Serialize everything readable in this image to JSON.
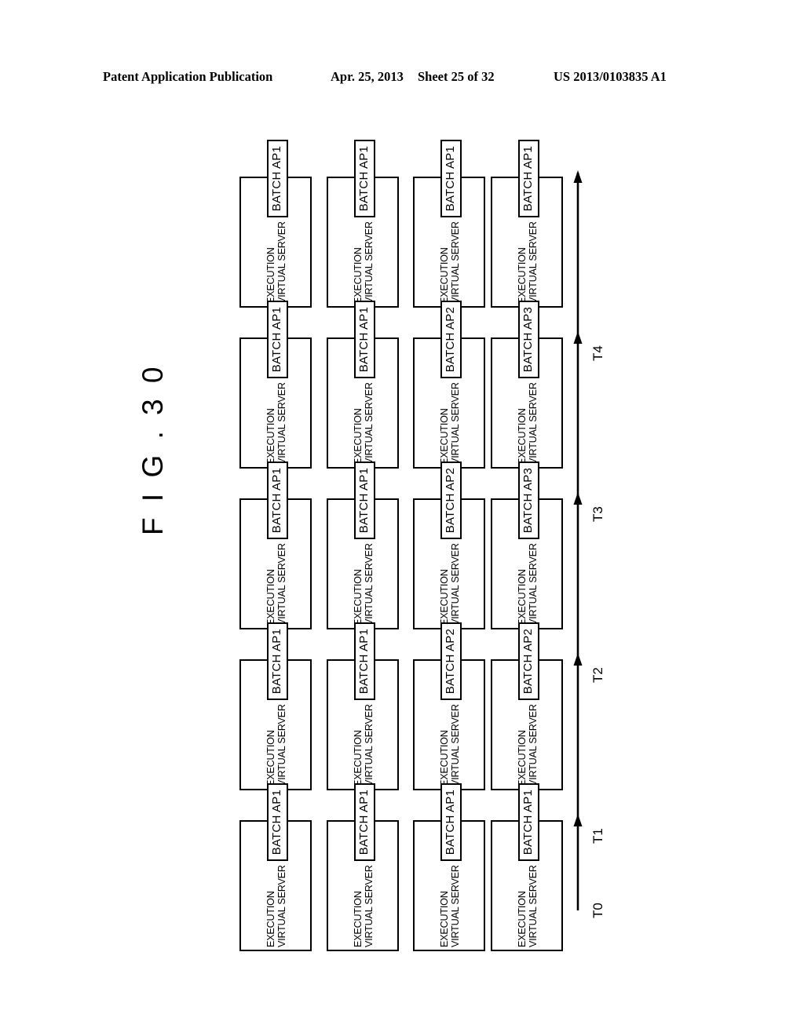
{
  "header": {
    "publication": "Patent Application Publication",
    "date": "Apr. 25, 2013",
    "sheet": "Sheet 25 of 32",
    "patent_number": "US 2013/0103835 A1"
  },
  "figure": {
    "label": "F I G . 3 0"
  },
  "diagram": {
    "server_title": "EXECUTION\nVIRTUAL SERVER",
    "time_groups": [
      {
        "time": "T4",
        "servers": [
          {
            "title": "EXECUTION\nVIRTUAL SERVER",
            "batch": "BATCH AP1"
          },
          {
            "title": "EXECUTION\nVIRTUAL SERVER",
            "batch": "BATCH AP1"
          },
          {
            "title": "EXECUTION\nVIRTUAL SERVER",
            "batch": "BATCH AP1"
          },
          {
            "title": "EXECUTION\nVIRTUAL SERVER",
            "batch": "BATCH AP1"
          }
        ]
      },
      {
        "time": "T3",
        "servers": [
          {
            "title": "EXECUTION\nVIRTUAL SERVER",
            "batch": "BATCH AP1"
          },
          {
            "title": "EXECUTION\nVIRTUAL SERVER",
            "batch": "BATCH AP1"
          },
          {
            "title": "EXECUTION\nVIRTUAL SERVER",
            "batch": "BATCH AP2"
          },
          {
            "title": "EXECUTION\nVIRTUAL SERVER",
            "batch": "BATCH AP3"
          }
        ]
      },
      {
        "time": "T2",
        "servers": [
          {
            "title": "EXECUTION\nVIRTUAL SERVER",
            "batch": "BATCH AP1"
          },
          {
            "title": "EXECUTION\nVIRTUAL SERVER",
            "batch": "BATCH AP1"
          },
          {
            "title": "EXECUTION\nVIRTUAL SERVER",
            "batch": "BATCH AP2"
          },
          {
            "title": "EXECUTION\nVIRTUAL SERVER",
            "batch": "BATCH AP3"
          }
        ]
      },
      {
        "time": "T1",
        "servers": [
          {
            "title": "EXECUTION\nVIRTUAL SERVER",
            "batch": "BATCH AP1"
          },
          {
            "title": "EXECUTION\nVIRTUAL SERVER",
            "batch": "BATCH AP1"
          },
          {
            "title": "EXECUTION\nVIRTUAL SERVER",
            "batch": "BATCH AP2"
          },
          {
            "title": "EXECUTION\nVIRTUAL SERVER",
            "batch": "BATCH AP2"
          }
        ]
      },
      {
        "time": "T0",
        "servers": [
          {
            "title": "EXECUTION\nVIRTUAL SERVER",
            "batch": "BATCH AP1"
          },
          {
            "title": "EXECUTION\nVIRTUAL SERVER",
            "batch": "BATCH AP1"
          },
          {
            "title": "EXECUTION\nVIRTUAL SERVER",
            "batch": "BATCH AP1"
          },
          {
            "title": "EXECUTION\nVIRTUAL SERVER",
            "batch": "BATCH AP1"
          }
        ]
      }
    ],
    "timeline": {
      "marks": [
        "T0",
        "T1",
        "T2",
        "T3",
        "T4"
      ],
      "direction": "upward",
      "line_color": "#000000"
    }
  }
}
